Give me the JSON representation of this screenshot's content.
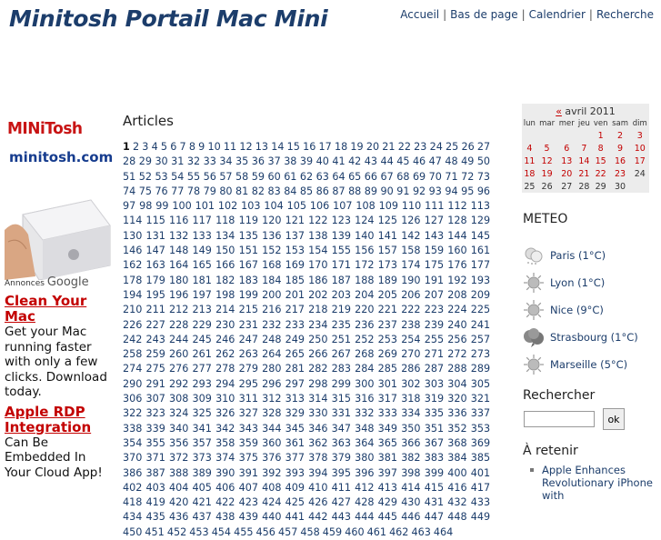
{
  "header": {
    "site_title": "Minitosh Portail Mac Mini",
    "nav": [
      "Accueil",
      "Bas de page",
      "Calendrier",
      "Recherche"
    ]
  },
  "left_column": {
    "logo_text": "MINiTosh",
    "logo_sub": "minitosh.com",
    "ads_label_prefix": "Annonces",
    "ads_label_brand": "Google",
    "ads": [
      {
        "title": "Clean Your Mac",
        "text": "Get your Mac running faster with only a few clicks. Download today."
      },
      {
        "title": "Apple RDP Integration",
        "text": "Can Be Embedded In Your Cloud App!"
      }
    ]
  },
  "main": {
    "heading": "Articles",
    "current_page": 1,
    "last_page_visible": 464
  },
  "calendar": {
    "prev_label": "«",
    "month": "avril 2011",
    "weekdays": [
      "lun",
      "mar",
      "mer",
      "jeu",
      "ven",
      "sam",
      "dim"
    ],
    "weeks": [
      [
        "",
        "",
        "",
        "",
        "1",
        "2",
        "3"
      ],
      [
        "4",
        "5",
        "6",
        "7",
        "8",
        "9",
        "10"
      ],
      [
        "11",
        "12",
        "13",
        "14",
        "15",
        "16",
        "17"
      ],
      [
        "18",
        "19",
        "20",
        "21",
        "22",
        "23",
        "24"
      ],
      [
        "25",
        "26",
        "27",
        "28",
        "29",
        "30",
        ""
      ]
    ],
    "linked_days": [
      "1",
      "2",
      "3",
      "4",
      "5",
      "6",
      "7",
      "8",
      "9",
      "10",
      "11",
      "12",
      "13",
      "14",
      "15",
      "16",
      "17",
      "18",
      "19",
      "20",
      "21",
      "22",
      "23"
    ]
  },
  "meteo": {
    "title": "METEO",
    "items": [
      {
        "label": "Paris (1°C)",
        "icon": "cloudy-icon"
      },
      {
        "label": "Lyon (1°C)",
        "icon": "sun-icon"
      },
      {
        "label": "Nice (9°C)",
        "icon": "sun-icon"
      },
      {
        "label": "Strasbourg (1°C)",
        "icon": "storm-cloud-icon"
      },
      {
        "label": "Marseille (5°C)",
        "icon": "sun-icon"
      }
    ]
  },
  "search": {
    "title": "Rechercher",
    "input_value": "",
    "button_label": "ok"
  },
  "retenir": {
    "title": "À retenir",
    "items": [
      "Apple Enhances Revolutionary iPhone with"
    ]
  },
  "colors": {
    "title": "#1c3d6b",
    "link": "#1c3d6b",
    "ad_title": "#c30000",
    "calendar_bg": "#ececec"
  }
}
